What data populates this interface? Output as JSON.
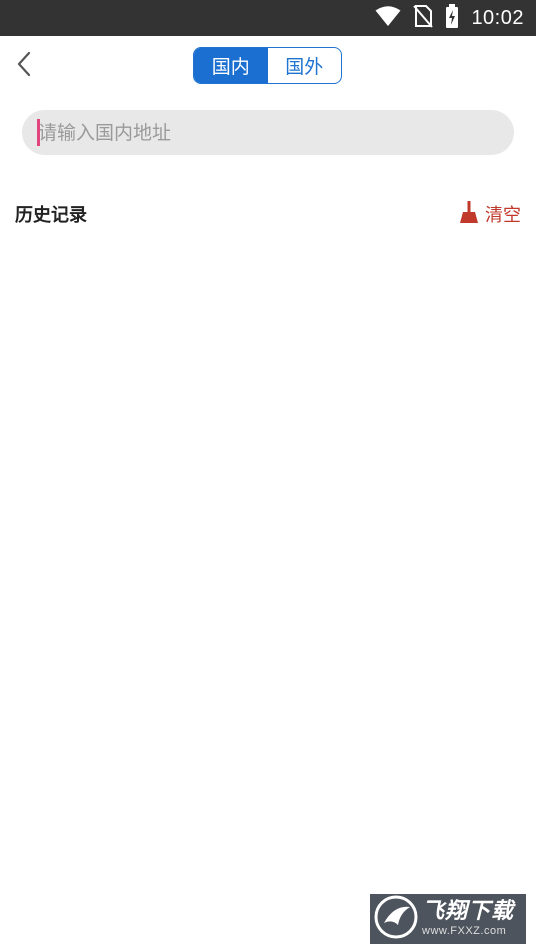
{
  "status_bar": {
    "time": "10:02",
    "icons": [
      "wifi-icon",
      "no-sim-icon",
      "battery-charging-icon"
    ]
  },
  "header": {
    "back_icon": "chevron-left-icon",
    "tabs": [
      {
        "label": "国内",
        "active": true
      },
      {
        "label": "国外",
        "active": false
      }
    ]
  },
  "search": {
    "placeholder": "请输入国内地址",
    "value": ""
  },
  "history": {
    "title": "历史记录",
    "clear_label": "清空",
    "clear_icon": "broom-icon",
    "items": []
  },
  "watermark": {
    "brand": "飞翔下载",
    "site": "www.FXXZ.com"
  },
  "colors": {
    "accent": "#1a6fd0",
    "clear": "#c0392b",
    "status_bar": "#333333",
    "search_bg": "#e8e8e8"
  }
}
